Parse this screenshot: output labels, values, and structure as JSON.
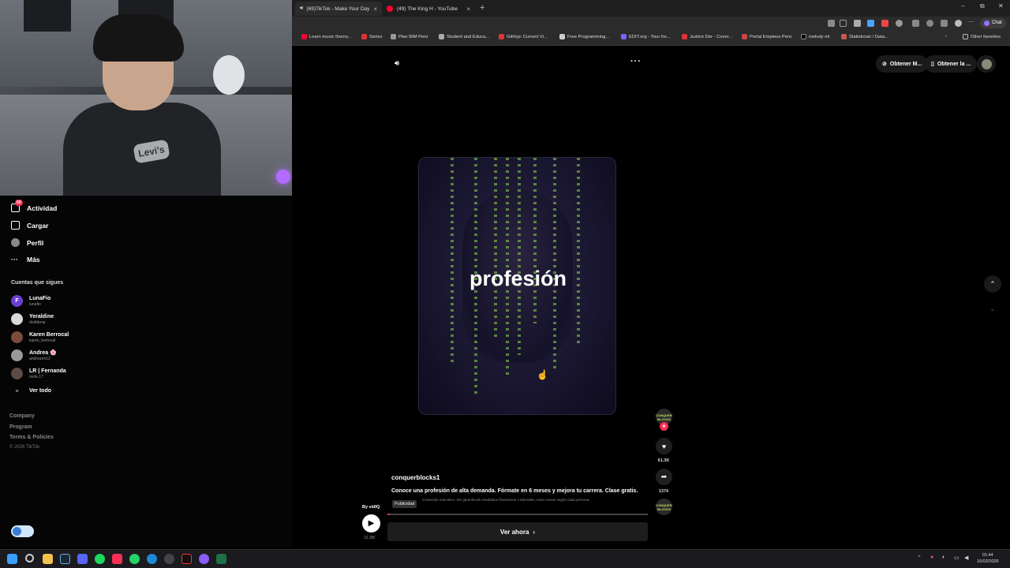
{
  "browser": {
    "tabs": [
      {
        "label": "(69)TikTok - Make Your Day",
        "active": true
      },
      {
        "label": "(49) The King H - YouTube",
        "active": false
      }
    ],
    "new_tab_label": "+",
    "chat_label": "Chat",
    "bookmarks": [
      "Learn music theory...",
      "Series",
      "Plan BIM Perú",
      "Student and Educa...",
      "GitHyp: Current Vi...",
      "Free Programming...",
      "EDIT.org - Your fre...",
      "Justice Der - Cover...",
      "Portal Empleos Perú",
      "melody ml",
      "Statistician / Data..."
    ],
    "other_favorites": "Other favorites",
    "chevron_label": "›",
    "window_controls": {
      "minimize": "–",
      "restore": "⧉",
      "close": "✕"
    }
  },
  "sidebar": {
    "nav": [
      {
        "label": "Actividad",
        "badge": "69"
      },
      {
        "label": "Cargar"
      },
      {
        "label": "Perfil"
      },
      {
        "label": "Más"
      }
    ],
    "following_title": "Cuentas que sigues",
    "accounts": [
      {
        "name": "LunaFio",
        "handle": "lunafio",
        "initial": "F"
      },
      {
        "name": "Yeraldine",
        "handle": "dndldnnp",
        "initial": ""
      },
      {
        "name": "Karen Berrocal",
        "handle": "karen_berrocal",
        "initial": ""
      },
      {
        "name": "Andrea 🌸",
        "handle": "andrearm12",
        "initial": ""
      },
      {
        "name": "LR | Fernanda",
        "handle": "mxfe.17",
        "initial": ""
      }
    ],
    "see_all": "Ver todo",
    "footer_links": [
      "Company",
      "Program",
      "Terms & Policies"
    ],
    "copyright": "© 2026 TikTok"
  },
  "page": {
    "get_app_1": "Obtener M...",
    "get_app_2": "Obtener la ...",
    "more_label": "···",
    "volume_icon": "speaker-icon"
  },
  "video": {
    "caption": "profesión",
    "likes": "61.3K",
    "shares": "1374",
    "brand_avatar": "CONQUER BLOCKS",
    "progress": 0.01
  },
  "ad": {
    "username": "conquerblocks1",
    "description": "Conoce una profesión de alta demanda. Fórmate en 6 meses y mejora tu carrera. Clase gratis.",
    "tag": "Publicidad",
    "disclaimer": "Contenido educativo. Sin garantía de resultados financieros o laborales, estos varían según cada persona.",
    "by": "By vidIQ",
    "views": "12.3M",
    "cta": "Ver ahora"
  },
  "taskbar": {
    "time": "01:44",
    "date": "16/02/2026"
  }
}
